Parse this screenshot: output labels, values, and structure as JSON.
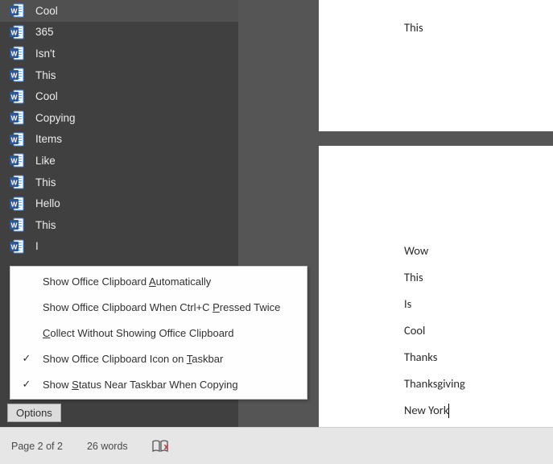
{
  "clipboard": {
    "items": [
      {
        "label": "Cool"
      },
      {
        "label": "365"
      },
      {
        "label": "Isn't"
      },
      {
        "label": "This"
      },
      {
        "label": "Cool"
      },
      {
        "label": "Copying"
      },
      {
        "label": "Items"
      },
      {
        "label": "Like"
      },
      {
        "label": "This"
      },
      {
        "label": "Hello"
      },
      {
        "label": "This"
      },
      {
        "label": "I"
      }
    ]
  },
  "options_menu": {
    "items": [
      {
        "checked": false,
        "pre": "Show Office Clipboard ",
        "ud": "A",
        "post": "utomatically"
      },
      {
        "checked": false,
        "pre": "Show Office Clipboard When Ctrl+C ",
        "ud": "P",
        "post": "ressed Twice"
      },
      {
        "checked": false,
        "pre": "",
        "ud": "C",
        "post": "ollect Without Showing Office Clipboard"
      },
      {
        "checked": true,
        "pre": "Show Office Clipboard Icon on ",
        "ud": "T",
        "post": "askbar"
      },
      {
        "checked": true,
        "pre": "Show ",
        "ud": "S",
        "post": "tatus Near Taskbar When Copying"
      }
    ],
    "button": "Options"
  },
  "document": {
    "top_page": [
      "This"
    ],
    "bottom_page": [
      "Wow",
      "This",
      "Is",
      "Cool",
      "Thanks",
      "Thanksgiving",
      "New York"
    ]
  },
  "status": {
    "page": "Page 2 of 2",
    "words": "26 words"
  },
  "checkmark": "✓"
}
